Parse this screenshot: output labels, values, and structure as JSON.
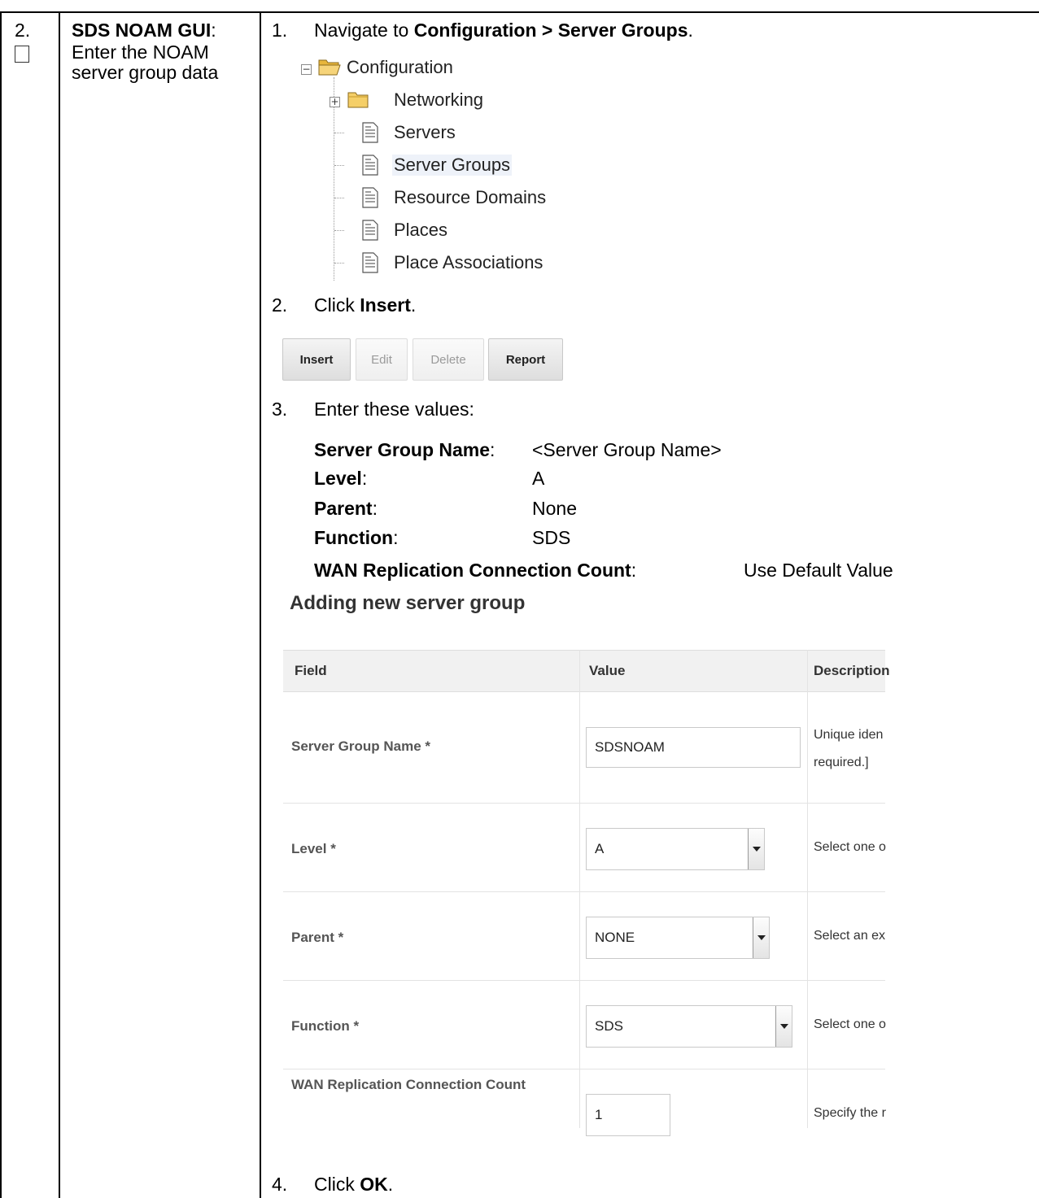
{
  "step": {
    "number": "2.",
    "title": "SDS NOAM GUI",
    "title_suffix": ":",
    "description_lines": [
      "Enter the NOAM",
      "server group data"
    ]
  },
  "instructions": {
    "s1_num": "1.",
    "s1_pre": "Navigate to ",
    "s1_bold": "Configuration > Server Groups",
    "s1_post": ".",
    "s2_num": "2.",
    "s2_pre": "Click ",
    "s2_bold": "Insert",
    "s2_post": ".",
    "s3_num": "3.",
    "s3_text": "Enter these values:",
    "s4_num": "4.",
    "s4_pre": "Click ",
    "s4_bold": "OK",
    "s4_post": "."
  },
  "tree": {
    "root": "Configuration",
    "networking": "Networking",
    "servers": "Servers",
    "server_groups": "Server Groups",
    "resource_domains": "Resource Domains",
    "places": "Places",
    "place_associations": "Place Associations",
    "icons": {
      "root": "folder-open-icon",
      "networking": "folder-icon",
      "leaf": "document-icon"
    }
  },
  "toolbar": {
    "insert": "Insert",
    "edit": "Edit",
    "delete": "Delete",
    "report": "Report"
  },
  "values": {
    "sgn_label": "Server Group Name",
    "sgn_value": "<Server Group Name>",
    "level_label": "Level",
    "level_value": "A",
    "parent_label": "Parent",
    "parent_value": "None",
    "function_label": "Function",
    "function_value": "SDS",
    "wan_label": "WAN Replication Connection Count",
    "wan_value": "Use Default Value",
    "colon": ":"
  },
  "form": {
    "title": "Adding new server group",
    "col_field": "Field",
    "col_value": "Value",
    "col_description": "Description",
    "rows": [
      {
        "label": "Server Group Name *",
        "value": "SDSNOAM",
        "desc1": "Unique iden",
        "desc2": "required.]"
      },
      {
        "label": "Level *",
        "value": "A",
        "desc1": "Select one o"
      },
      {
        "label": "Parent *",
        "value": "NONE",
        "desc1": "Select an ex"
      },
      {
        "label": "Function *",
        "value": "SDS",
        "desc1": "Select one o"
      },
      {
        "label": "WAN Replication Connection Count",
        "value": "1",
        "desc1": "Specify the r"
      }
    ]
  },
  "colors": {
    "selected_bg": "#eef2f9",
    "form_header_bg": "#f0f0f0",
    "folder": "#f0c04a"
  }
}
